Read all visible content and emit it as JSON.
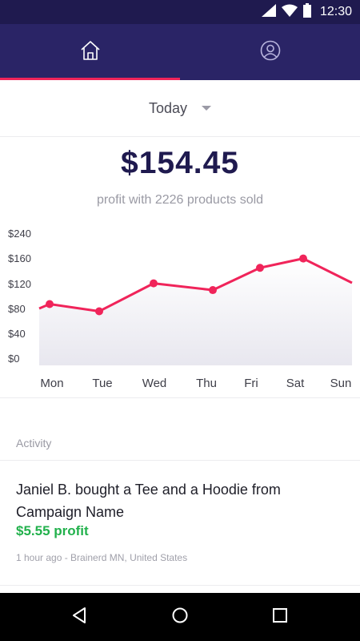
{
  "status_bar": {
    "time": "12:30"
  },
  "tabs": [
    {
      "name": "home",
      "icon": "home-icon",
      "active": true
    },
    {
      "name": "profile",
      "icon": "profile-icon",
      "active": false
    }
  ],
  "colors": {
    "header": "#2a2466",
    "accent": "#f0245a",
    "profit": "#22b14c",
    "total": "#1f1a4f"
  },
  "period": {
    "label": "Today"
  },
  "summary": {
    "total": "$154.45",
    "subtitle": "profit with 2226 products sold"
  },
  "chart_data": {
    "type": "area",
    "categories": [
      "Mon",
      "Tue",
      "Wed",
      "Thu",
      "Fri",
      "Sat",
      "Sun"
    ],
    "values": [
      103,
      89,
      143,
      130,
      173,
      191,
      144
    ],
    "y_ticks": [
      "$240",
      "$160",
      "$120",
      "$80",
      "$40",
      "$0"
    ],
    "ylim": [
      0,
      240
    ],
    "grid": false
  },
  "activity": {
    "header": "Activity",
    "items": [
      {
        "text": "Janiel B. bought a Tee and a Hoodie from Campaign Name",
        "profit": "$5.55 profit",
        "meta": "1 hour ago - Brainerd MN, United States"
      }
    ]
  },
  "nav": [
    "back-icon",
    "home-circle-icon",
    "recents-icon"
  ]
}
